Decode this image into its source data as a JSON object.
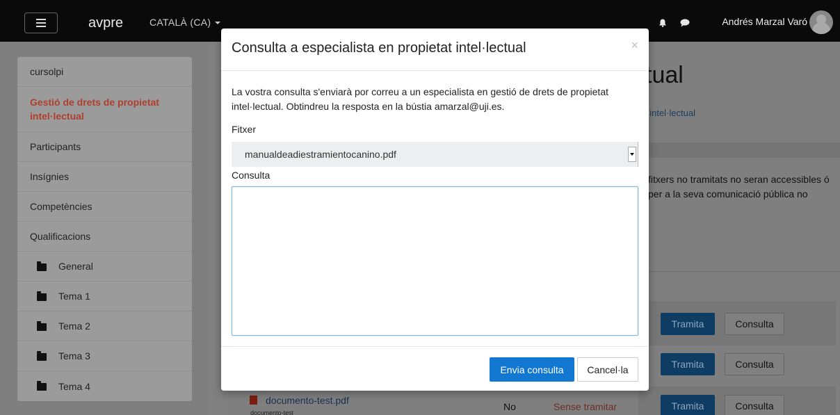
{
  "navbar": {
    "brand": "avpre",
    "language": "CATALÀ (CA)",
    "username": "Andrés Marzal Varó"
  },
  "sidebar": {
    "items": [
      {
        "label": "cursolpi"
      },
      {
        "label": "Gestió de drets de propietat intel·lectual",
        "active": true
      },
      {
        "label": "Participants"
      },
      {
        "label": "Insígnies"
      },
      {
        "label": "Competències"
      },
      {
        "label": "Qualificacions"
      },
      {
        "label": "General",
        "folder": true
      },
      {
        "label": "Tema 1",
        "folder": true
      },
      {
        "label": "Tema 2",
        "folder": true
      },
      {
        "label": "Tema 3",
        "folder": true
      },
      {
        "label": "Tema 4",
        "folder": true
      }
    ]
  },
  "background": {
    "title_fragment": "tual",
    "link_fragment": "t intel·lectual",
    "text_fragment": "fitxers no tramitats no seran accessibles ó per a la seva comunicació pública no",
    "tramita_label": "Tramita",
    "consulta_label": "Consulta",
    "file_name": "documento-test.pdf",
    "file_sub": "documento-test",
    "file_no": "No",
    "file_status": "Sense tramitar"
  },
  "modal": {
    "title": "Consulta a especialista en propietat intel·lectual",
    "close_glyph": "×",
    "intro": "La vostra consulta s'enviarà por correu a un especialista en gestió de drets de propietat intel·lectual. Obtindreu la resposta en la bústia amarzal@uji.es.",
    "file_label": "Fitxer",
    "file_selected": "manualdeadiestramientocanino.pdf",
    "query_label": "Consulta",
    "query_value": "",
    "send_label": "Envia consulta",
    "cancel_label": "Cancel·la"
  },
  "colors": {
    "primary": "#1177d1",
    "active_sidebar": "#b03e2f",
    "navbar": "#0a0a0a"
  }
}
